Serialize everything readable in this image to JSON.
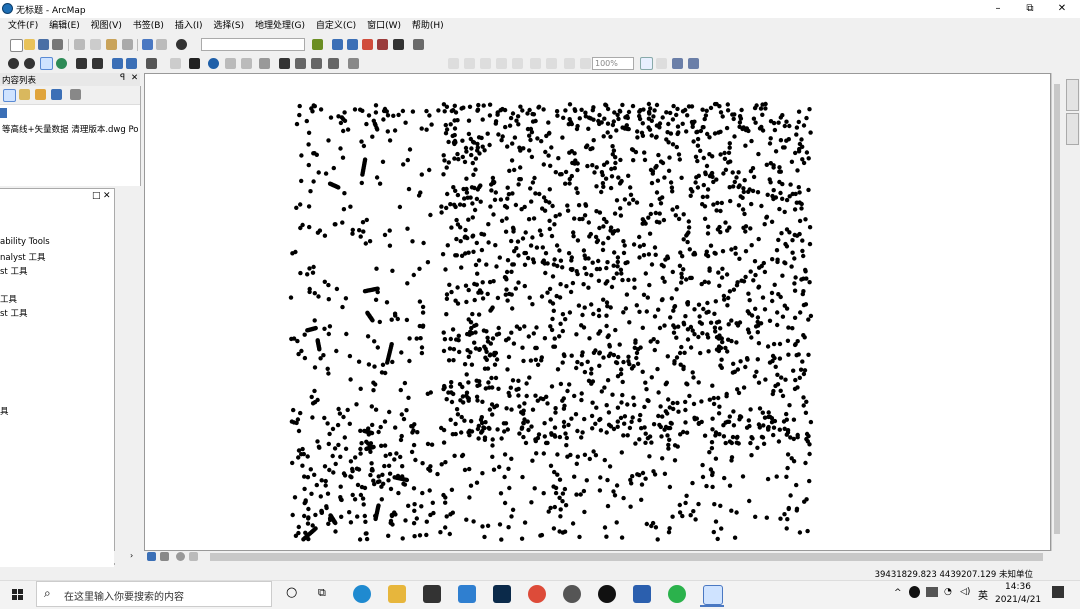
{
  "window": {
    "title": "无标题 - ArcMap",
    "minimize": "–",
    "restore": "⧉",
    "close": "✕"
  },
  "menu": [
    "文件(F)",
    "编辑(E)",
    "视图(V)",
    "书签(B)",
    "插入(I)",
    "选择(S)",
    "地理处理(G)",
    "自定义(C)",
    "窗口(W)",
    "帮助(H)"
  ],
  "toolbar": {
    "zoom_value": "100%"
  },
  "toc": {
    "title": "内容列表",
    "pin": "ꟼ",
    "close": "✕",
    "layer_name": "等高线+矢量数据 清理版本.dwg Po"
  },
  "tool_panel": {
    "items": [
      "ability Tools",
      "nalyst 工具",
      "st 工具",
      "工具",
      "st 工具",
      "具"
    ]
  },
  "status": {
    "coordinates": "39431829.823  4439207.129 未知单位"
  },
  "taskbar": {
    "search_placeholder": "在这里输入你要搜索的内容",
    "time": "14:36",
    "date": "2021/4/21",
    "ime": "英",
    "tray_icons": [
      "chevron-up-icon",
      "network-icon",
      "volume-icon"
    ]
  },
  "colors": {
    "map_point": "#000000",
    "toolbar_bg": "#f0f0f0",
    "taskbar_bg": "#f3f3f3"
  }
}
